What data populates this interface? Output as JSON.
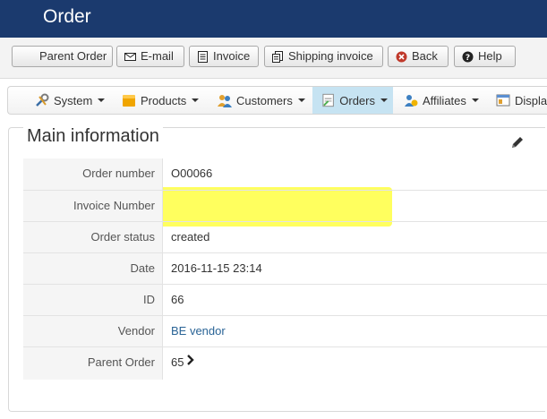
{
  "header": {
    "title": "Order"
  },
  "toolbar": {
    "parent_order": "Parent Order",
    "email": "E-mail",
    "invoice": "Invoice",
    "shipping_invoice": "Shipping invoice",
    "back": "Back",
    "help": "Help"
  },
  "menu": {
    "items": [
      {
        "label": "System",
        "icon": "wrench-icon"
      },
      {
        "label": "Products",
        "icon": "box-icon"
      },
      {
        "label": "Customers",
        "icon": "users-icon"
      },
      {
        "label": "Orders",
        "icon": "orders-icon",
        "active": true
      },
      {
        "label": "Affiliates",
        "icon": "affiliates-icon"
      },
      {
        "label": "Displa",
        "icon": "display-icon"
      }
    ]
  },
  "main": {
    "legend": "Main information",
    "fields": [
      {
        "label": "Order number",
        "value": "O00066"
      },
      {
        "label": "Invoice Number",
        "value": ""
      },
      {
        "label": "Order status",
        "value": "created"
      },
      {
        "label": "Date",
        "value": "2016-11-15 23:14"
      },
      {
        "label": "ID",
        "value": "66"
      },
      {
        "label": "Vendor",
        "value": "BE vendor"
      },
      {
        "label": "Parent Order",
        "value": "65"
      }
    ]
  },
  "colors": {
    "header_bg": "#1b3a6e",
    "active_menu_bg": "#c6e3f2",
    "link": "#2a6496",
    "highlight": "#ffff28"
  }
}
